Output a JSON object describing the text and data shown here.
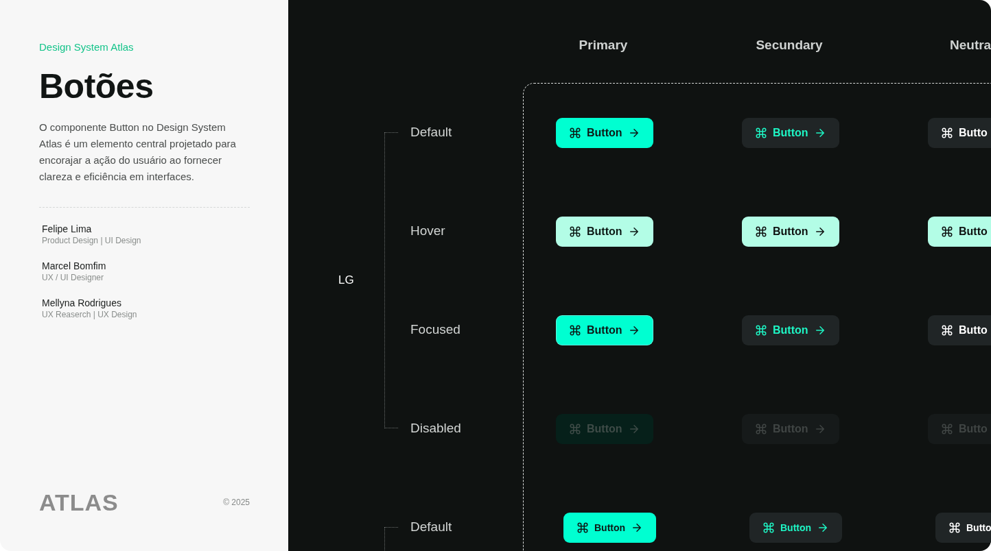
{
  "sidebar": {
    "eyebrow": "Design System Atlas",
    "title": "Botões",
    "description": "O componente Button no Design System Atlas é um elemento central projetado para encorajar a ação do usuário ao fornecer clareza e eficiência em interfaces.",
    "authors": [
      {
        "name": "Felipe Lima",
        "role": "Product Design | UI Design"
      },
      {
        "name": "Marcel Bomfim",
        "role": "UX / UI Designer"
      },
      {
        "name": "Mellyna Rodrigues",
        "role": "UX Reaserch | UX Design"
      }
    ],
    "logo": "ATLAS",
    "copyright": "© 2025"
  },
  "columns": [
    {
      "header": "Primary",
      "kind": "primary",
      "clipped": false
    },
    {
      "header": "Secundary",
      "kind": "secondary",
      "clipped": false
    },
    {
      "header": "Neutra",
      "kind": "neutral",
      "clipped": true
    }
  ],
  "groups": [
    {
      "label": "LG",
      "kind": "lg",
      "rows": [
        {
          "state": "Default",
          "kind": "default",
          "buttons": [
            "Button",
            "Button",
            "Butto"
          ]
        },
        {
          "state": "Hover",
          "kind": "hover",
          "buttons": [
            "Button",
            "Button",
            "Butto"
          ]
        },
        {
          "state": "Focused",
          "kind": "focused",
          "buttons": [
            "Button",
            "Button",
            "Butto"
          ]
        },
        {
          "state": "Disabled",
          "kind": "disabled",
          "buttons": [
            "Button",
            "Button",
            "Butto"
          ]
        }
      ]
    },
    {
      "kind": "sm",
      "rows": [
        {
          "state": "Default",
          "kind": "default",
          "buttons": [
            "Button",
            "Button",
            "Butto"
          ]
        }
      ]
    }
  ]
}
